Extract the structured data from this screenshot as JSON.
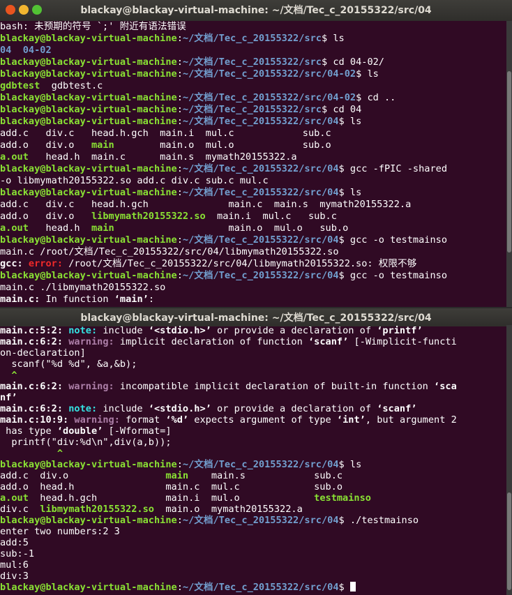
{
  "window1": {
    "title": "blackay@blackay-virtual-machine: ~/文档/Tec_c_20155322/src/04",
    "lines": [
      [
        [
          "",
          "bash: 未预期的符号 `;' 附近有语法错误"
        ]
      ],
      [
        [
          "g",
          "blackay@blackay-virtual-machine"
        ],
        [
          "",
          ":"
        ],
        [
          "b",
          "~/文档/Tec_c_20155322/src"
        ],
        [
          "",
          "$ ls"
        ]
      ],
      [
        [
          "b",
          "04  04-02"
        ]
      ],
      [
        [
          "g",
          "blackay@blackay-virtual-machine"
        ],
        [
          "",
          ":"
        ],
        [
          "b",
          "~/文档/Tec_c_20155322/src"
        ],
        [
          "",
          "$ cd 04-02/"
        ]
      ],
      [
        [
          "g",
          "blackay@blackay-virtual-machine"
        ],
        [
          "",
          ":"
        ],
        [
          "b",
          "~/文档/Tec_c_20155322/src/04-02"
        ],
        [
          "",
          "$ ls"
        ]
      ],
      [
        [
          "g",
          "gdbtest"
        ],
        [
          "",
          "  gdbtest.c"
        ]
      ],
      [
        [
          "g",
          "blackay@blackay-virtual-machine"
        ],
        [
          "",
          ":"
        ],
        [
          "b",
          "~/文档/Tec_c_20155322/src/04-02"
        ],
        [
          "",
          "$ cd .."
        ]
      ],
      [
        [
          "g",
          "blackay@blackay-virtual-machine"
        ],
        [
          "",
          ":"
        ],
        [
          "b",
          "~/文档/Tec_c_20155322/src"
        ],
        [
          "",
          "$ cd 04"
        ]
      ],
      [
        [
          "g",
          "blackay@blackay-virtual-machine"
        ],
        [
          "",
          ":"
        ],
        [
          "b",
          "~/文档/Tec_c_20155322/src/04"
        ],
        [
          "",
          "$ ls"
        ]
      ],
      [
        [
          "",
          "add.c   div.c   head.h.gch  main.i  mul.c            sub.c"
        ]
      ],
      [
        [
          "",
          "add.o   div.o   "
        ],
        [
          "g",
          "main"
        ],
        [
          "",
          "        main.o  mul.o            sub.o"
        ]
      ],
      [
        [
          "g",
          "a.out"
        ],
        [
          "",
          "   head.h  main.c      main.s  mymath20155322.a"
        ]
      ],
      [
        [
          "g",
          "blackay@blackay-virtual-machine"
        ],
        [
          "",
          ":"
        ],
        [
          "b",
          "~/文档/Tec_c_20155322/src/04"
        ],
        [
          "",
          "$ gcc -fPIC -shared"
        ]
      ],
      [
        [
          "",
          "-o libmymath20155322.so add.c div.c sub.c mul.c"
        ]
      ],
      [
        [
          "g",
          "blackay@blackay-virtual-machine"
        ],
        [
          "",
          ":"
        ],
        [
          "b",
          "~/文档/Tec_c_20155322/src/04"
        ],
        [
          "",
          "$ ls"
        ]
      ],
      [
        [
          "",
          "add.c   div.c   head.h.gch              main.c  main.s  mymath20155322.a"
        ]
      ],
      [
        [
          "",
          "add.o   div.o   "
        ],
        [
          "g",
          "libmymath20155322.so"
        ],
        [
          "",
          "  main.i  mul.c   sub.c"
        ]
      ],
      [
        [
          "g",
          "a.out"
        ],
        [
          "",
          "   head.h  "
        ],
        [
          "g",
          "main"
        ],
        [
          "",
          "                    main.o  mul.o   sub.o"
        ]
      ],
      [
        [
          "g",
          "blackay@blackay-virtual-machine"
        ],
        [
          "",
          ":"
        ],
        [
          "b",
          "~/文档/Tec_c_20155322/src/04"
        ],
        [
          "",
          "$ gcc -o testmainso"
        ]
      ],
      [
        [
          "",
          "main.c /root/文档/Tec_c_20155322/src/04/libmymath20155322.so"
        ]
      ],
      [
        [
          "bd",
          "gcc: "
        ],
        [
          "r",
          "error: "
        ],
        [
          "",
          "/root/文档/Tec_c_20155322/src/04/libmymath20155322.so: 权限不够"
        ]
      ],
      [
        [
          "g",
          "blackay@blackay-virtual-machine"
        ],
        [
          "",
          ":"
        ],
        [
          "b",
          "~/文档/Tec_c_20155322/src/04"
        ],
        [
          "",
          "$ gcc -o testmainso"
        ]
      ],
      [
        [
          "",
          "main.c ./libmymath20155322.so"
        ]
      ],
      [
        [
          "bd",
          "main.c:"
        ],
        [
          "",
          " In function "
        ],
        [
          "bd",
          "‘main’"
        ],
        [
          "",
          ":"
        ]
      ]
    ]
  },
  "window2": {
    "title": "blackay@blackay-virtual-machine: ~/文档/Tec_c_20155322/src/04",
    "lines": [
      [
        [
          "bd",
          "main.c:5:2: "
        ],
        [
          "c",
          "note: "
        ],
        [
          "",
          "include "
        ],
        [
          "bd",
          "‘<stdio.h>’"
        ],
        [
          "",
          " or provide a declaration of "
        ],
        [
          "bd",
          "‘printf’"
        ]
      ],
      [
        [
          "bd",
          "main.c:6:2: "
        ],
        [
          "m",
          "warning: "
        ],
        [
          "",
          "implicit declaration of function "
        ],
        [
          "bd",
          "‘scanf’"
        ],
        [
          "",
          " [-Wimplicit-functi"
        ]
      ],
      [
        [
          "",
          "on-declaration]"
        ]
      ],
      [
        [
          "",
          "  scanf(\"%d %d\", &a,&b);"
        ]
      ],
      [
        [
          "g",
          "  ^"
        ]
      ],
      [
        [
          "bd",
          "main.c:6:2: "
        ],
        [
          "m",
          "warning: "
        ],
        [
          "",
          "incompatible implicit declaration of built-in function "
        ],
        [
          "bd",
          "‘sca"
        ]
      ],
      [
        [
          "bd",
          "nf’"
        ]
      ],
      [
        [
          "bd",
          "main.c:6:2: "
        ],
        [
          "c",
          "note: "
        ],
        [
          "",
          "include "
        ],
        [
          "bd",
          "‘<stdio.h>’"
        ],
        [
          "",
          " or provide a declaration of "
        ],
        [
          "bd",
          "‘scanf’"
        ]
      ],
      [
        [
          "bd",
          "main.c:10:9: "
        ],
        [
          "m",
          "warning: "
        ],
        [
          "",
          "format "
        ],
        [
          "bd",
          "‘%d’"
        ],
        [
          "",
          " expects argument of type "
        ],
        [
          "bd",
          "‘int’"
        ],
        [
          "",
          ", but argument 2"
        ]
      ],
      [
        [
          "",
          " has type "
        ],
        [
          "bd",
          "‘double’"
        ],
        [
          "",
          " [-Wformat=]"
        ]
      ],
      [
        [
          "",
          "  printf(\"div:%d\\n\",div(a,b));"
        ]
      ],
      [
        [
          "g",
          "          ^"
        ]
      ],
      [
        [
          "g",
          "blackay@blackay-virtual-machine"
        ],
        [
          "",
          ":"
        ],
        [
          "b",
          "~/文档/Tec_c_20155322/src/04"
        ],
        [
          "",
          "$ ls"
        ]
      ],
      [
        [
          "",
          "add.c  div.o                 "
        ],
        [
          "g",
          "main"
        ],
        [
          "",
          "    main.s            sub.c"
        ]
      ],
      [
        [
          "",
          "add.o  head.h                main.c  mul.c             sub.o"
        ]
      ],
      [
        [
          "g",
          "a.out"
        ],
        [
          "",
          "  head.h.gch            main.i  mul.o             "
        ],
        [
          "g",
          "testmainso"
        ]
      ],
      [
        [
          "",
          "div.c  "
        ],
        [
          "g",
          "libmymath20155322.so"
        ],
        [
          "",
          "  main.o  mymath20155322.a"
        ]
      ],
      [
        [
          "g",
          "blackay@blackay-virtual-machine"
        ],
        [
          "",
          ":"
        ],
        [
          "b",
          "~/文档/Tec_c_20155322/src/04"
        ],
        [
          "",
          "$ ./testmainso"
        ]
      ],
      [
        [
          "",
          "enter two numbers:2 3"
        ]
      ],
      [
        [
          "",
          "add:5"
        ]
      ],
      [
        [
          "",
          "sub:-1"
        ]
      ],
      [
        [
          "",
          "mul:6"
        ]
      ],
      [
        [
          "",
          "div:3"
        ]
      ],
      [
        [
          "g",
          "blackay@blackay-virtual-machine"
        ],
        [
          "",
          ":"
        ],
        [
          "b",
          "~/文档/Tec_c_20155322/src/04"
        ],
        [
          "",
          "$ "
        ]
      ]
    ]
  },
  "colors": {
    "background": "#300a24",
    "prompt_user": "#8ae234",
    "prompt_path": "#729fcf",
    "error": "#ef2929",
    "warning": "#ad7fa8",
    "note": "#34e2e2"
  }
}
